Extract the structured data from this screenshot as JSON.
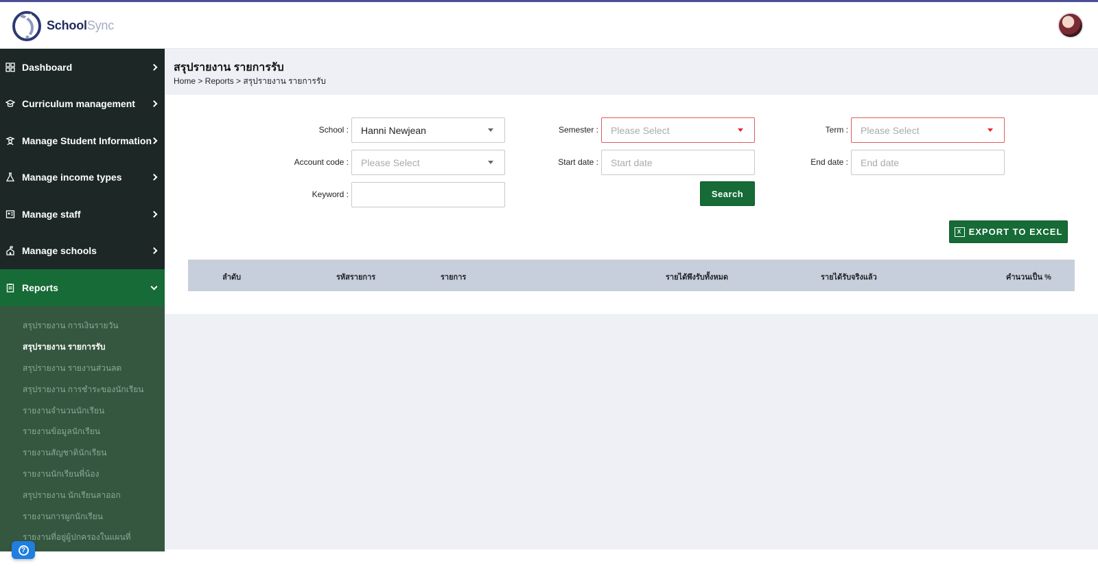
{
  "app": {
    "logo_school": "School",
    "logo_sync": "Sync"
  },
  "sidebar": {
    "items": [
      {
        "label": "Dashboard",
        "icon": "dashboard-icon"
      },
      {
        "label": "Curriculum management",
        "icon": "graduation-cap-icon"
      },
      {
        "label": "Manage Student Information",
        "icon": "student-icon"
      },
      {
        "label": "Manage income types",
        "icon": "flask-icon"
      },
      {
        "label": "Manage staff",
        "icon": "staff-icon"
      },
      {
        "label": "Manage schools",
        "icon": "school-icon"
      },
      {
        "label": "Reports",
        "icon": "clipboard-icon"
      }
    ],
    "sub_items": [
      "สรุปรายงาน การเงินรายวัน",
      "สรุปรายงาน รายการรับ",
      "สรุปรายงาน รายงานส่วนลด",
      "สรุปรายงาน การชำระของนักเรียน",
      "รายงานจำนวนนักเรียน",
      "รายงานข้อมูลนักเรียน",
      "รายงานสัญชาตินักเรียน",
      "รายงานนักเรียนพี่น้อง",
      "สรุปรายงาน นักเรียนลาออก",
      "รายงานการผูกนักเรียน",
      "รายงานที่อยู่ผู้ปกครองในแผนที่"
    ]
  },
  "page": {
    "title": "สรุปรายงาน รายการรับ",
    "breadcrumb": "Home > Reports > สรุปรายงาน รายการรับ"
  },
  "filters": {
    "school_label": "School :",
    "school_value": "Hanni Newjean",
    "semester_label": "Semester :",
    "semester_placeholder": "Please Select",
    "term_label": "Term :",
    "term_placeholder": "Please Select",
    "account_code_label": "Account code :",
    "account_code_placeholder": "Please Select",
    "start_date_label": "Start date :",
    "start_date_placeholder": "Start date",
    "end_date_label": "End date :",
    "end_date_placeholder": "End date",
    "keyword_label": "Keyword :",
    "search_button": "Search"
  },
  "export_button": "EXPORT TO EXCEL",
  "table": {
    "columns": [
      "ลำดับ",
      "รหัสรายการ",
      "รายการ",
      "รายได้พึงรับทั้งหมด",
      "รายได้รับจริงแล้ว",
      "คำนวนเป็น %"
    ]
  },
  "colors": {
    "primary_green": "#166b36",
    "sidebar_bg": "#1c2726",
    "error_border": "#e2595f"
  }
}
